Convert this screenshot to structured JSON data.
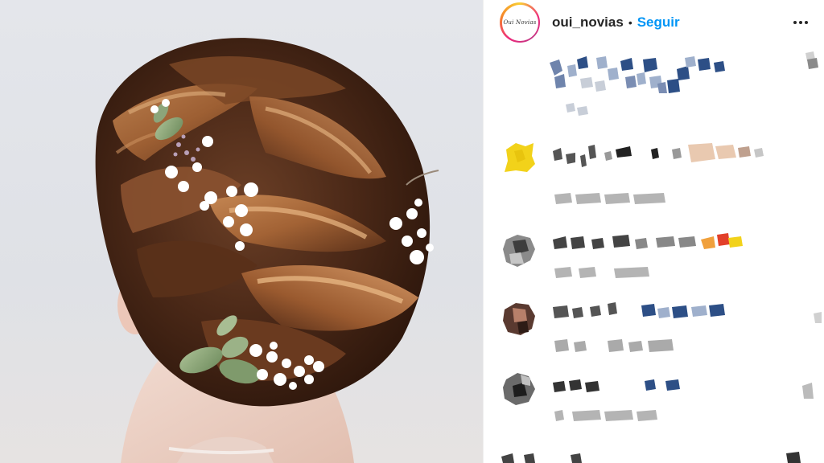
{
  "post": {
    "account": {
      "username": "oui_novias",
      "avatar_text": "Oui Novias",
      "separator": "•",
      "follow_label": "Seguir"
    },
    "photo": {
      "subject_icon": "bridal-updo-photo-icon"
    }
  },
  "colors": {
    "follow_blue": "#0095f6",
    "username_text": "#262626",
    "story_ring_start": "#f9ce34",
    "story_ring_mid": "#ee2a7b",
    "story_ring_end": "#c13584",
    "pixel_blue": "#2d4f86",
    "pixel_yellow": "#f2d21a",
    "pixel_orange": "#f0a03c",
    "pixel_red": "#e2402a"
  },
  "icons": {
    "more_options": "more-options-icon"
  }
}
